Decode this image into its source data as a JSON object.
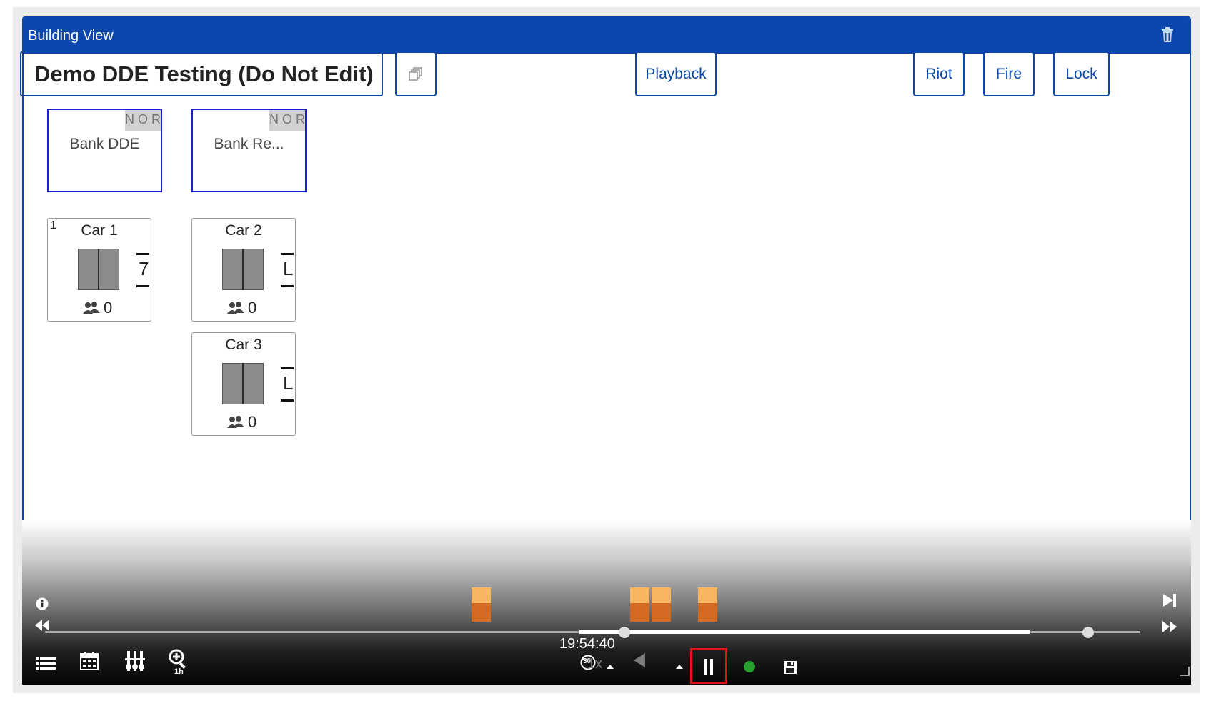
{
  "window": {
    "title": "Building View"
  },
  "header": {
    "building_name": "Demo DDE Testing (Do Not Edit)"
  },
  "toolbar": {
    "playback_label": "Playback",
    "riot_label": "Riot",
    "fire_label": "Fire",
    "lock_label": "Lock"
  },
  "banks": [
    {
      "label": "Bank DDE",
      "status": "NOR"
    },
    {
      "label": "Bank Re...",
      "status": "NOR"
    }
  ],
  "cars": [
    {
      "number": "1",
      "label": "Car 1",
      "floor": "7",
      "occupancy": "0"
    },
    {
      "number": "",
      "label": "Car 2",
      "floor": "L",
      "occupancy": "0"
    },
    {
      "number": "",
      "label": "Car 3",
      "floor": "L",
      "occupancy": "0"
    }
  ],
  "playback": {
    "time": "19:54:40",
    "speed": "1x",
    "skip_seconds": "30",
    "zoom_level": "1h",
    "progress_fraction": 0.56
  },
  "colors": {
    "accent": "#0b47ad",
    "marker_light": "#f7b461",
    "marker_dark": "#d46a22",
    "live": "#27a12e",
    "pause_highlight": "#e0141a"
  }
}
